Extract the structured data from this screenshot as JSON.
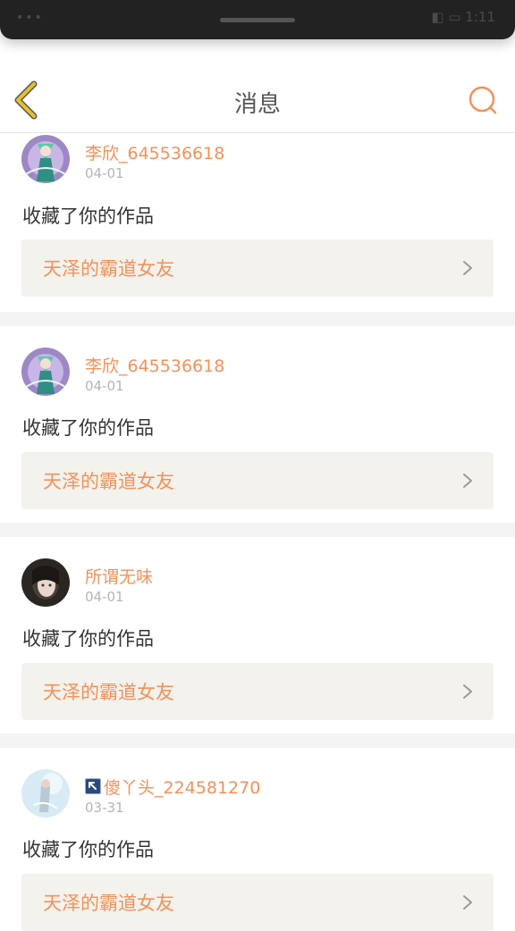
{
  "status_bar": {
    "left_text": "•••",
    "right_text": "◧ ▭ 1:11"
  },
  "header": {
    "title": "消息"
  },
  "messages": [
    {
      "user_name": "李欣_645536618",
      "date": "04-01",
      "action": "收藏了你的作品",
      "work_title": "天泽的霸道女友",
      "avatar": "anime-avatar"
    },
    {
      "user_name": "李欣_645536618",
      "date": "04-01",
      "action": "收藏了你的作品",
      "work_title": "天泽的霸道女友",
      "avatar": "anime-avatar"
    },
    {
      "user_name": "所谓无味",
      "date": "04-01",
      "action": "收藏了你的作品",
      "work_title": "天泽的霸道女友",
      "avatar": "girl-photo-avatar"
    },
    {
      "user_name": "傻丫头_224581270",
      "date": "03-31",
      "action": "收藏了你的作品",
      "work_title": "天泽的霸道女友",
      "avatar": "light-photo-avatar"
    }
  ],
  "colors": {
    "accent": "#f4915a",
    "back_icon": "#e6c22b",
    "link_bg": "#f3f2ec",
    "divider": "#f5f4f4"
  },
  "icons": {
    "back": "chevron-left-icon",
    "search": "search-icon",
    "arrow": "chevron-right-icon"
  }
}
